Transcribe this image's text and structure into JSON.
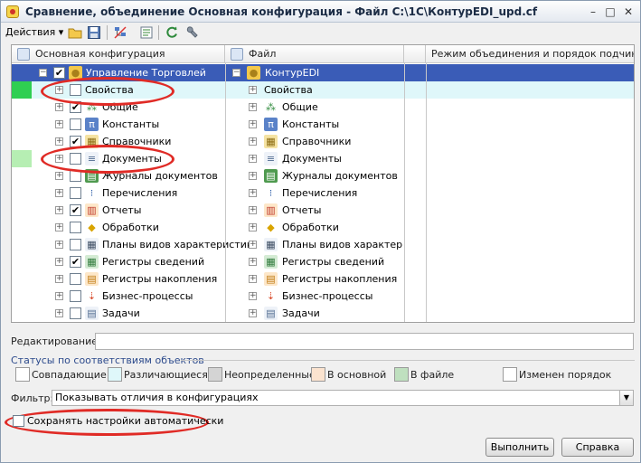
{
  "window": {
    "title": "Сравнение, объединение Основная конфигурация - Файл C:\\1C\\КонтурEDI_upd.cf",
    "minimize_glyph": "–",
    "maximize_glyph": "□",
    "close_glyph": "✕"
  },
  "toolbar": {
    "actions_label": "Действия",
    "actions_arrow": "▾",
    "icons": [
      "open-folder-icon",
      "save-disk-icon",
      "compare-tree-icon",
      "object-properties-icon",
      "refresh-icon",
      "settings-wrench-icon"
    ]
  },
  "tree": {
    "headers": {
      "main_config": "Основная конфигурация",
      "file": "Файл",
      "merge_mode": "Режим объединения и порядок подчиненн..."
    },
    "rows": [
      {
        "left": "Управление Торговлей",
        "right": "КонтурEDI",
        "checked": true,
        "icon": "config-root-icon",
        "selected": true
      },
      {
        "left": "Свойства",
        "right": "Свойства",
        "checked": false,
        "icon": "",
        "highlight": true,
        "status": "green"
      },
      {
        "left": "Общие",
        "right": "Общие",
        "checked": true,
        "icon": "common-objects-icon"
      },
      {
        "left": "Константы",
        "right": "Константы",
        "checked": false,
        "icon": "constants-icon"
      },
      {
        "left": "Справочники",
        "right": "Справочники",
        "checked": true,
        "icon": "catalogs-icon"
      },
      {
        "left": "Документы",
        "right": "Документы",
        "checked": false,
        "icon": "documents-icon",
        "status": "lightgreen"
      },
      {
        "left": "Журналы документов",
        "right": "Журналы документов",
        "checked": false,
        "icon": "document-journals-icon"
      },
      {
        "left": "Перечисления",
        "right": "Перечисления",
        "checked": false,
        "icon": "enums-icon"
      },
      {
        "left": "Отчеты",
        "right": "Отчеты",
        "checked": true,
        "icon": "reports-icon"
      },
      {
        "left": "Обработки",
        "right": "Обработки",
        "checked": false,
        "icon": "data-processors-icon"
      },
      {
        "left": "Планы видов характеристик",
        "right": "Планы видов характеристик",
        "checked": false,
        "icon": "characteristic-types-icon"
      },
      {
        "left": "Регистры сведений",
        "right": "Регистры сведений",
        "checked": true,
        "icon": "information-registers-icon"
      },
      {
        "left": "Регистры накопления",
        "right": "Регистры накопления",
        "checked": false,
        "icon": "accumulation-registers-icon"
      },
      {
        "left": "Бизнес-процессы",
        "right": "Бизнес-процессы",
        "checked": false,
        "icon": "business-processes-icon"
      },
      {
        "left": "Задачи",
        "right": "Задачи",
        "checked": false,
        "icon": "tasks-icon"
      }
    ]
  },
  "editing": {
    "label": "Редактирование:",
    "value": ""
  },
  "statuses": {
    "group_title": "Статусы по соответствиям объектов",
    "items": [
      {
        "label": "Совпадающие",
        "color": "#ffffff"
      },
      {
        "label": "Различающиеся",
        "color": "#dff7fa"
      },
      {
        "label": "Неопределенные",
        "color": "#d4d4d4"
      },
      {
        "label": "В основной",
        "color": "#fbe3cf"
      },
      {
        "label": "В файле",
        "color": "#bfe0bf"
      },
      {
        "label": "Изменен порядок",
        "color": "#ffffff"
      }
    ]
  },
  "filter": {
    "label": "Фильтр:",
    "value": "Показывать отличия в конфигурациях"
  },
  "save_settings": {
    "label": "Сохранять настройки автоматически",
    "checked": false
  },
  "buttons": {
    "execute": "Выполнить",
    "help": "Справка"
  },
  "colors": {
    "annotation_red": "#e02b26",
    "selection_blue": "#3a5cb7",
    "status_green": "#2fcf52",
    "status_lightgreen": "#b6eeb3"
  }
}
